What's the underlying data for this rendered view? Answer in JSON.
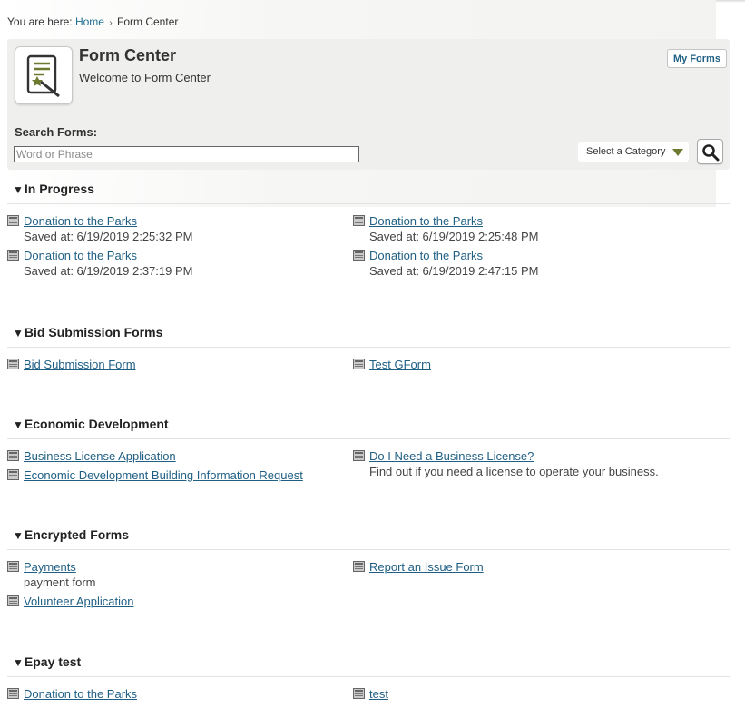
{
  "breadcrumb": {
    "prefix": "You are here:",
    "home": "Home",
    "sep": "›",
    "current": "Form Center"
  },
  "header": {
    "title": "Form Center",
    "subtitle": "Welcome to Form Center",
    "my_forms": "My Forms",
    "search_label": "Search Forms:",
    "search_placeholder": "Word or Phrase",
    "category_select": "Select a Category"
  },
  "sections": {
    "in_progress": {
      "title": "In Progress",
      "items": [
        {
          "label": "Donation to the Parks",
          "sub": "Saved at: 6/19/2019 2:25:32 PM"
        },
        {
          "label": "Donation to the Parks",
          "sub": "Saved at: 6/19/2019 2:25:48 PM"
        },
        {
          "label": "Donation to the Parks",
          "sub": "Saved at: 6/19/2019 2:37:19 PM"
        },
        {
          "label": "Donation to the Parks",
          "sub": "Saved at: 6/19/2019 2:47:15 PM"
        }
      ]
    },
    "bid": {
      "title": "Bid Submission Forms",
      "items": [
        {
          "label": "Bid Submission Form"
        },
        {
          "label": "Test GForm"
        }
      ]
    },
    "econ": {
      "title": "Economic Development",
      "items": [
        {
          "label": "Business License Application"
        },
        {
          "label": "Economic Development Building Information Request"
        },
        {
          "label": "Do I Need a Business License?",
          "sub": "Find out if you need a license to operate your business."
        }
      ]
    },
    "encrypted": {
      "title": "Encrypted Forms",
      "items": [
        {
          "label": "Payments",
          "sub": "payment form"
        },
        {
          "label": "Volunteer Application"
        },
        {
          "label": "Report an Issue Form"
        }
      ]
    },
    "epay": {
      "title": "Epay test",
      "items": [
        {
          "label": "Donation to the Parks"
        },
        {
          "label": "test"
        }
      ]
    }
  },
  "icons": {
    "form_icon": "form-wand-icon",
    "doc_icon": "form-document-icon",
    "search_icon": "magnifier-icon",
    "collapse_icon": "triangle-down-icon"
  },
  "colors": {
    "link": "#1f5f84",
    "accent": "#6b7a2f",
    "panel_bg": "#efefee"
  }
}
